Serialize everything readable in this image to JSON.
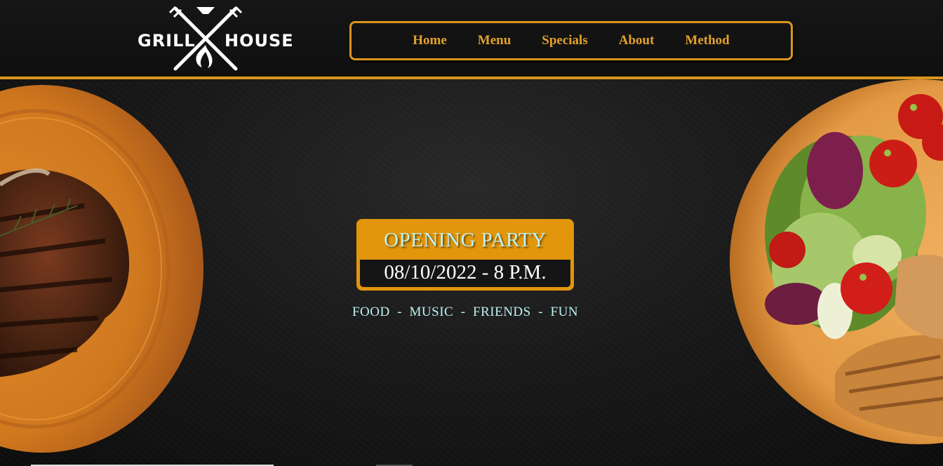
{
  "logo": {
    "left_text": "GRILL",
    "right_text": "HOUSE",
    "icon": "crossed-forks-flame-icon"
  },
  "nav": {
    "items": [
      {
        "label": "Home"
      },
      {
        "label": "Menu"
      },
      {
        "label": "Specials"
      },
      {
        "label": "About"
      },
      {
        "label": "Method"
      }
    ]
  },
  "hero": {
    "title": "OPENING PARTY",
    "date": "08/10/2022 - 8 P.M.",
    "tagline": "FOOD  -  MUSIC  -  FRIENDS  -  FUN",
    "left_image": "steak-on-wooden-board",
    "right_image": "salad-and-grilled-chicken-plate"
  },
  "colors": {
    "accent": "#d9951c",
    "card": "#e1960b",
    "title_text": "#bff2f2",
    "background": "#151515"
  }
}
